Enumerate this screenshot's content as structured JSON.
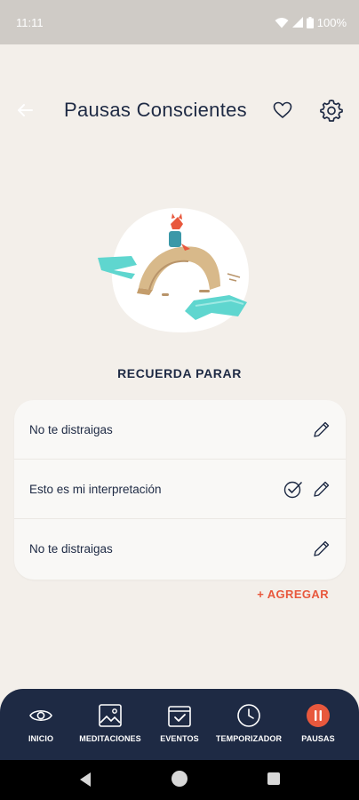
{
  "status": {
    "time": "11:11",
    "battery": "100%"
  },
  "header": {
    "title": "Pausas Conscientes"
  },
  "section": {
    "title": "RECUERDA PARAR"
  },
  "reminders": [
    {
      "text": "No te distraigas",
      "checked": false
    },
    {
      "text": "Esto es mi interpretación",
      "checked": true
    },
    {
      "text": "No te distraigas",
      "checked": false
    }
  ],
  "actions": {
    "add_label": "+ AGREGAR"
  },
  "bottom_nav": {
    "items": [
      {
        "label": "INICIO",
        "icon": "eye-icon"
      },
      {
        "label": "MEDITACIONES",
        "icon": "image-icon"
      },
      {
        "label": "EVENTOS",
        "icon": "calendar-check-icon"
      },
      {
        "label": "TEMPORIZADOR",
        "icon": "clock-icon"
      },
      {
        "label": "PAUSAS",
        "icon": "pause-icon",
        "active": true
      }
    ]
  },
  "colors": {
    "background": "#f3efea",
    "navy": "#1e2a44",
    "accent": "#e8583d"
  }
}
